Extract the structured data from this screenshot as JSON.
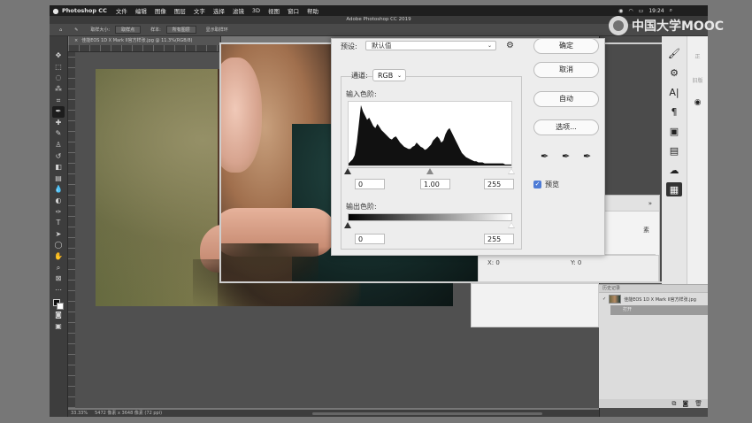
{
  "menubar": {
    "app": "Photoshop CC",
    "items": [
      "文件",
      "编辑",
      "图像",
      "图层",
      "文字",
      "选择",
      "滤镜",
      "3D",
      "视图",
      "窗口",
      "帮助"
    ],
    "time": "19:24"
  },
  "window_title": "Adobe Photoshop CC 2019",
  "options": {
    "size_label": "取样大小:",
    "size_value": "取样点",
    "sample_label": "样本:",
    "sample_value": "所有图层",
    "ring_label": "显示取样环"
  },
  "doc_tab": {
    "close": "×",
    "name": "佳能EOS 1D X Mark II官方样张.jpg @ 11.3%(RGB/8)"
  },
  "status": {
    "zoom": "33.33%",
    "info": "5472 像素 x 3648 像素 (72 ppi)"
  },
  "levels": {
    "preset_label": "预设:",
    "preset_value": "默认值",
    "channel_label": "通道:",
    "channel_value": "RGB",
    "input_label": "输入色阶:",
    "input_black": "0",
    "input_gamma": "1.00",
    "input_white": "255",
    "output_label": "输出色阶:",
    "output_black": "0",
    "output_white": "255",
    "ok": "确定",
    "cancel": "取消",
    "auto": "自动",
    "options": "选项...",
    "preview": "预览",
    "histogram": [
      2,
      4,
      6,
      10,
      22,
      40,
      58,
      52,
      48,
      44,
      46,
      42,
      38,
      36,
      40,
      37,
      34,
      32,
      30,
      28,
      26,
      25,
      27,
      28,
      25,
      22,
      20,
      18,
      17,
      16,
      16,
      18,
      19,
      22,
      20,
      18,
      17,
      15,
      16,
      18,
      20,
      24,
      26,
      28,
      26,
      22,
      24,
      30,
      34,
      36,
      32,
      28,
      24,
      20,
      16,
      12,
      10,
      8,
      7,
      6,
      5,
      4,
      4,
      3,
      3,
      3,
      2,
      2,
      2,
      2,
      2,
      2,
      2,
      2,
      2,
      2,
      1,
      1,
      1,
      1
    ]
  },
  "side_labels": {
    "top": "正",
    "mid": "旧版"
  },
  "panel_light": {
    "tail": "素"
  },
  "info_panel": {
    "x": "X: 0",
    "y": "Y: 0"
  },
  "history": {
    "header": "历史记录",
    "file": "佳能EOS 1D X Mark II官方样张.jpg",
    "step": "打开"
  },
  "watermark": "中国大学MOOC"
}
